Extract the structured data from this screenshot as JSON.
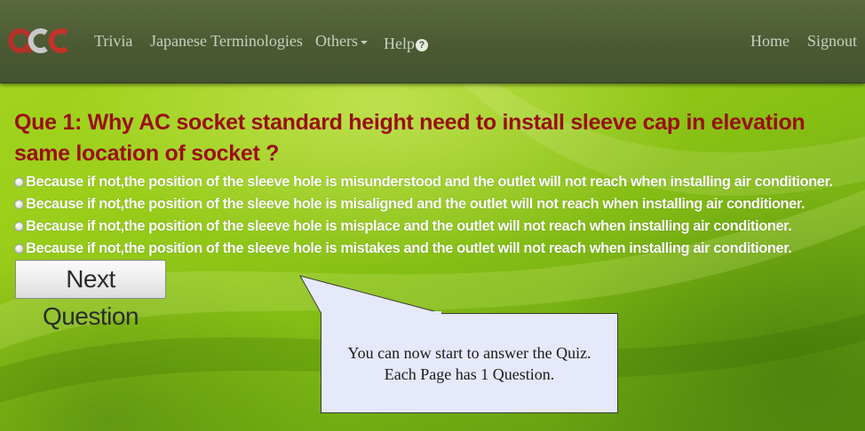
{
  "nav": {
    "logo_text": "QCC",
    "items": [
      {
        "label": "Trivia"
      },
      {
        "label": "Japanese Terminologies"
      },
      {
        "label": "Others"
      },
      {
        "label": "Help"
      }
    ],
    "right_items": [
      {
        "label": "Home"
      },
      {
        "label": "Signout"
      }
    ]
  },
  "quiz": {
    "question": "Que 1: Why AC socket standard height need to install sleeve cap in elevation same location of socket ?",
    "options": [
      "Because if not,the position of the sleeve hole is misunderstood and the outlet will not reach when installing air conditioner.",
      "Because if not,the position of the sleeve hole is misaligned and the outlet will not reach when installing air conditioner.",
      "Because if not,the position of the sleeve hole is misplace and the outlet will not reach when installing air conditioner.",
      "Because if not,the position of the sleeve hole is mistakes and the outlet will not reach when installing air conditioner."
    ],
    "next_label": "Next Question"
  },
  "callout": {
    "line1": "You can now start to answer the Quiz.",
    "line2": "Each Page has 1 Question."
  },
  "colors": {
    "navbar": "#4b5a33",
    "question_text": "#9b0f12",
    "option_text": "#ffffff",
    "background": "#9bcf1a",
    "callout_bg": "#e6e8fb"
  }
}
